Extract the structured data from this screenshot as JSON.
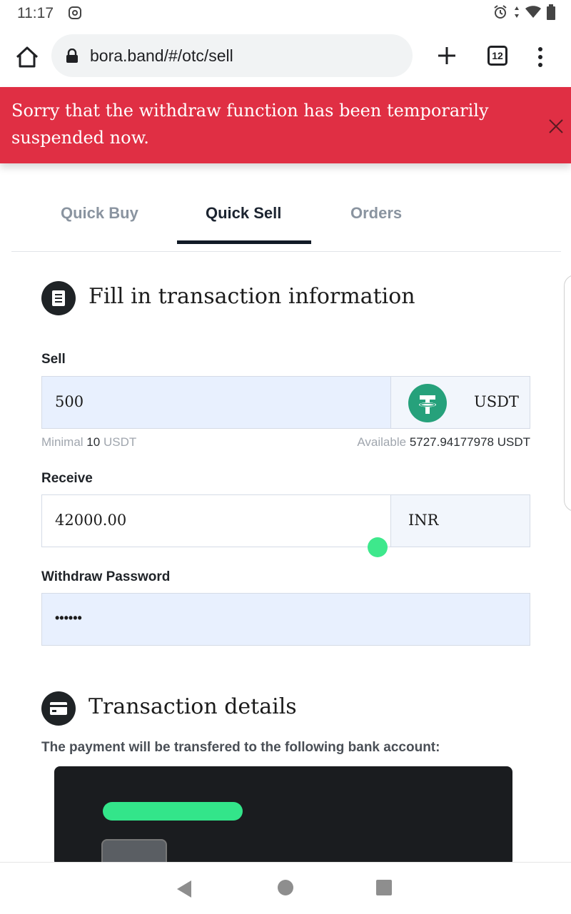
{
  "status_bar": {
    "time": "11:17"
  },
  "browser": {
    "url": "bora.band/#/otc/sell",
    "tab_count": "12"
  },
  "banner": {
    "message": "Sorry that the withdraw function has been temporarily suspended now."
  },
  "tabs": [
    {
      "label": "Quick Buy",
      "active": false
    },
    {
      "label": "Quick Sell",
      "active": true
    },
    {
      "label": "Orders",
      "active": false
    }
  ],
  "form": {
    "title": "Fill in transaction information",
    "sell": {
      "label": "Sell",
      "value": "500",
      "currency": "USDT",
      "minimal_label": "Minimal",
      "minimal_value": "10",
      "minimal_unit": "USDT",
      "available_label": "Available",
      "available_value": "5727.94177978 USDT"
    },
    "receive": {
      "label": "Receive",
      "value": "42000.00",
      "currency": "INR"
    },
    "password": {
      "label": "Withdraw Password",
      "value": "••••••"
    }
  },
  "details": {
    "title": "Transaction details",
    "note": "The payment will be transfered to the following bank account:"
  },
  "colors": {
    "banner": "#e02f44",
    "usdt": "#26a17b",
    "input_highlight": "#e8f0fe"
  }
}
